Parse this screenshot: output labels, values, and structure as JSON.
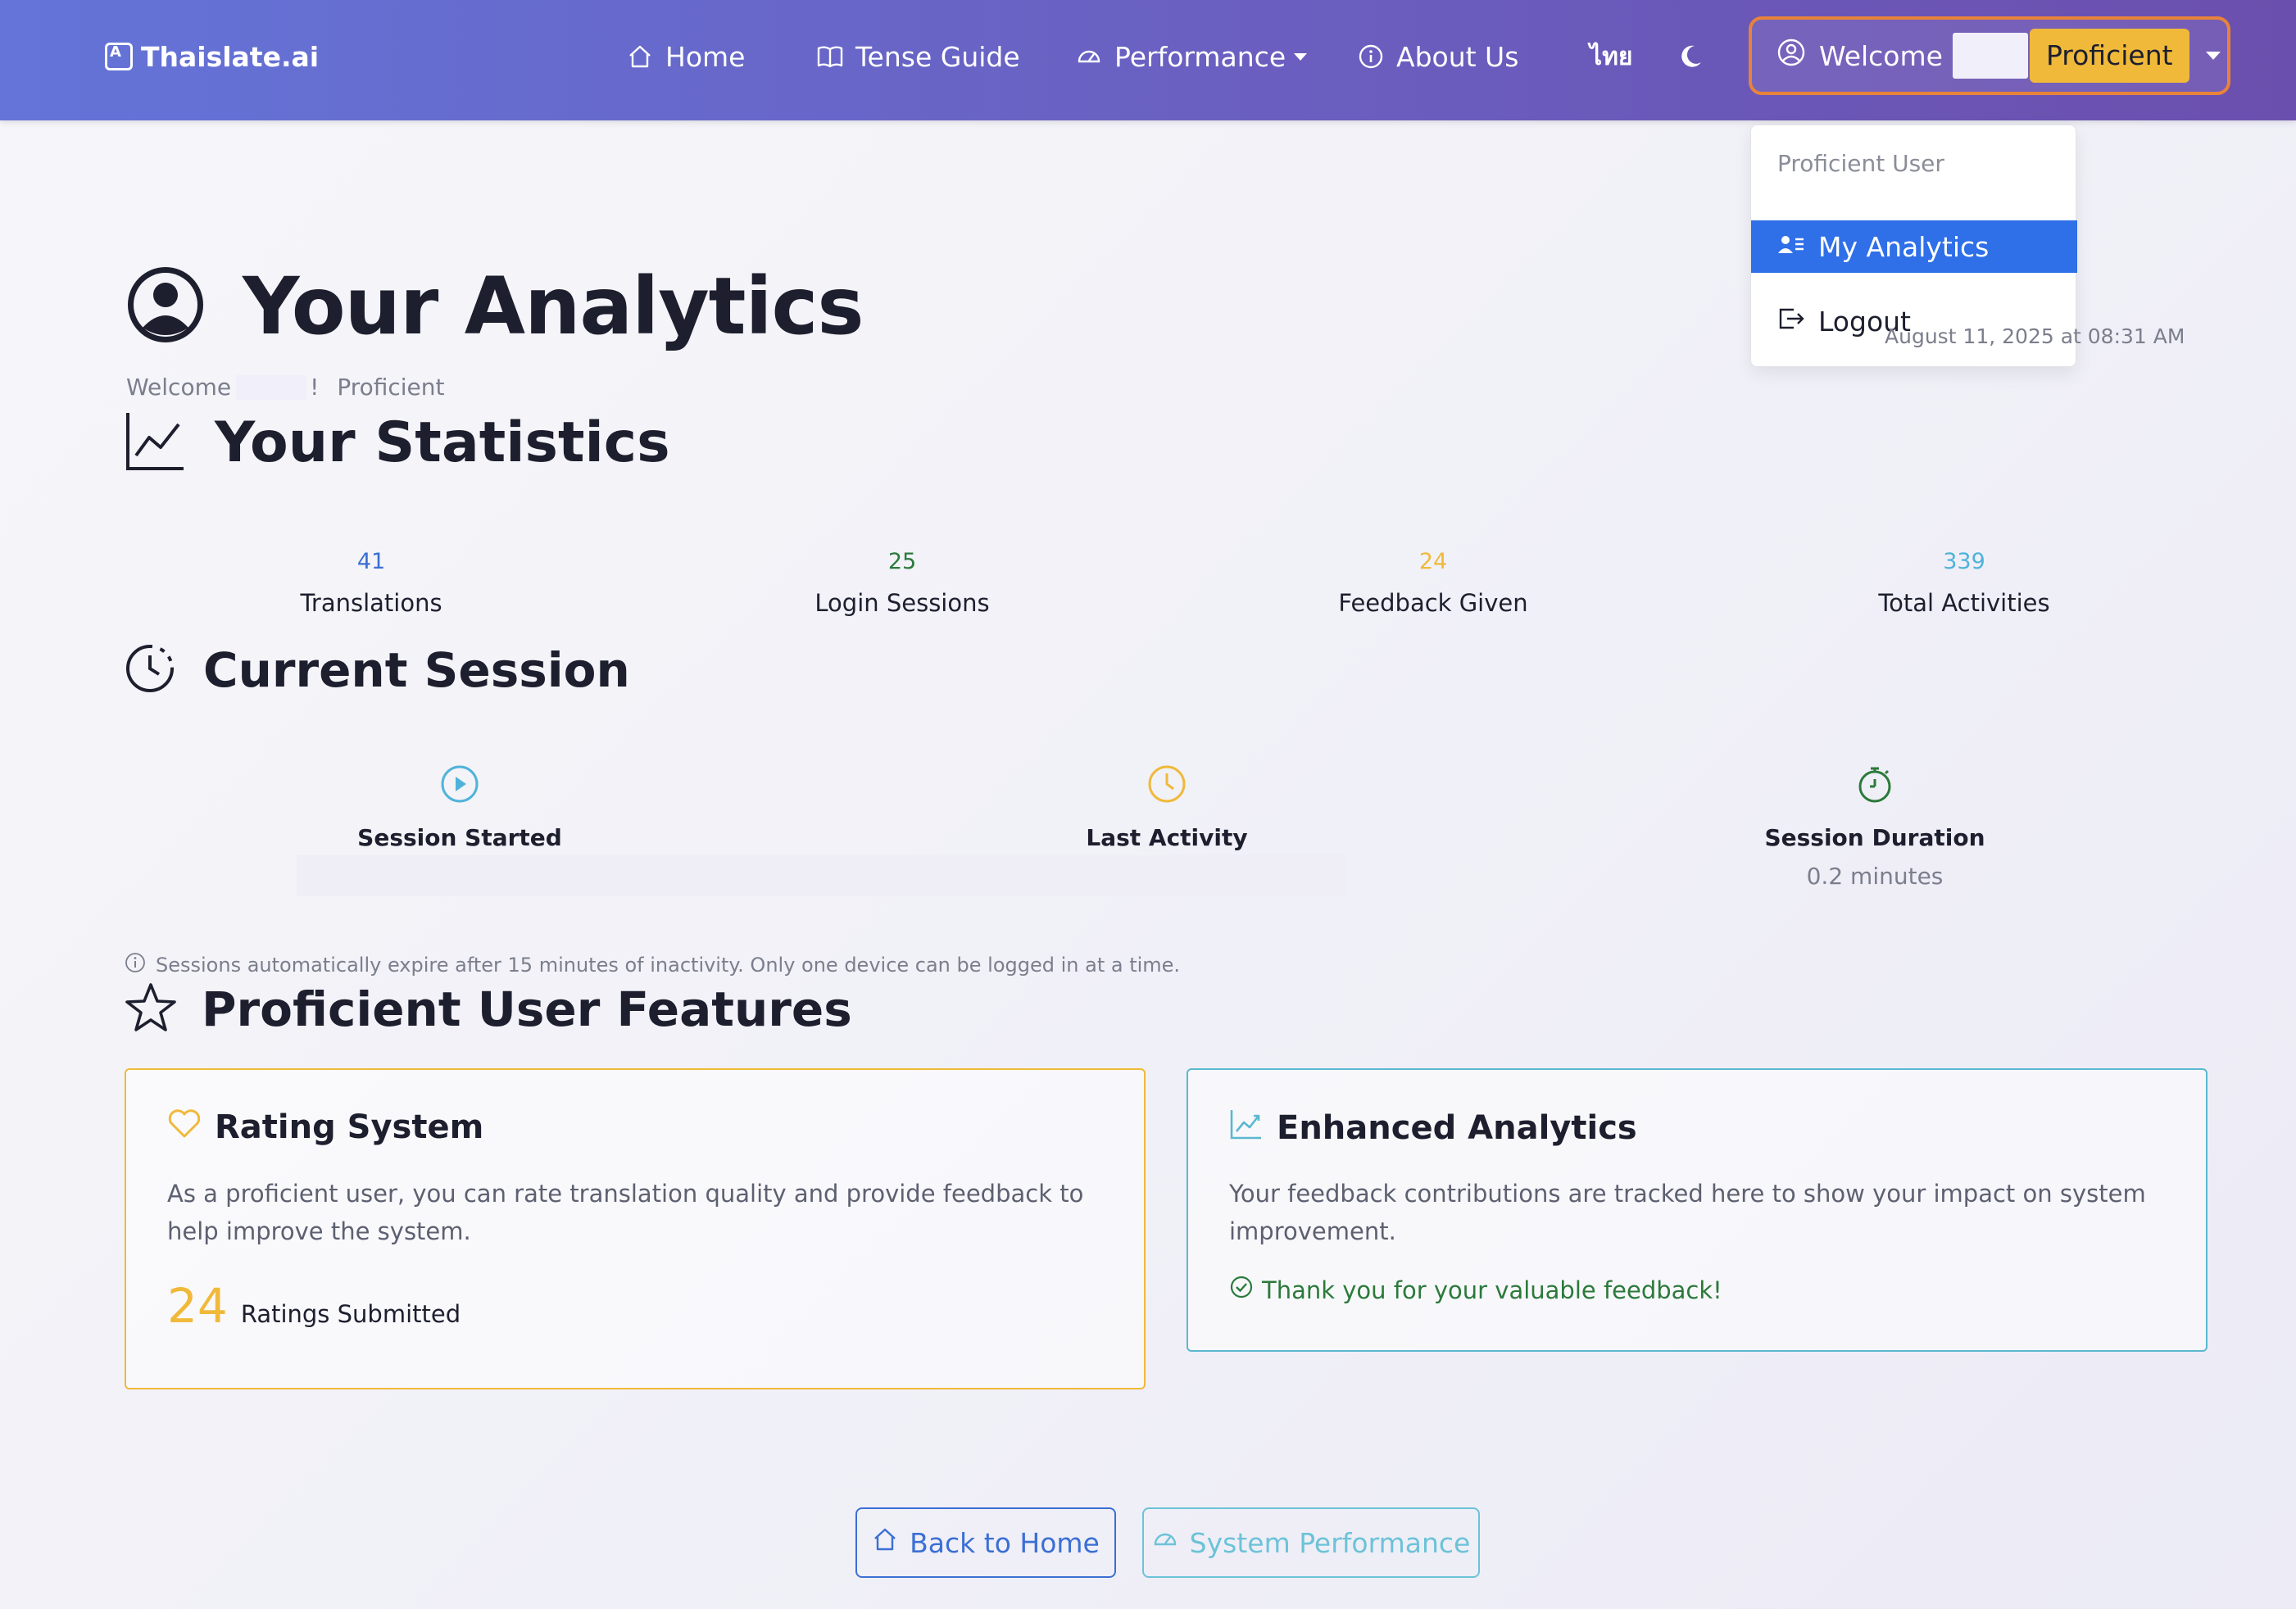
{
  "navbar": {
    "brand": "Thaislate.ai",
    "items": [
      {
        "label": "Home",
        "icon": "home-icon"
      },
      {
        "label": "Tense Guide",
        "icon": "book-icon"
      },
      {
        "label": "Performance",
        "icon": "speedometer-icon"
      },
      {
        "label": "About Us",
        "icon": "info-icon"
      }
    ],
    "language": "ไทย",
    "theme_icon": "moon-icon",
    "user": {
      "welcome": "Welcome",
      "level": "Proficient"
    }
  },
  "dropdown": {
    "header": "Proficient User",
    "items": [
      {
        "label": "My Analytics",
        "icon": "user-list-icon",
        "active": true
      },
      {
        "label": "Logout",
        "icon": "logout-icon"
      }
    ]
  },
  "page": {
    "title": "Your Analytics",
    "welcome": "Welcome",
    "welcome_punct": "!",
    "level": "Proficient",
    "timestamp": "August 11, 2025 at 08:31 AM"
  },
  "statistics": {
    "title": "Your Statistics",
    "items": [
      {
        "value": "41",
        "label": "Translations",
        "color": "#3b6fd4"
      },
      {
        "value": "25",
        "label": "Login Sessions",
        "color": "#2b7a3a"
      },
      {
        "value": "24",
        "label": "Feedback Given",
        "color": "#f0b93a"
      },
      {
        "value": "339",
        "label": "Total Activities",
        "color": "#4fb3d9"
      }
    ]
  },
  "session": {
    "title": "Current Session",
    "items": [
      {
        "label": "Session Started",
        "value": "",
        "icon": "play-circle-icon",
        "color": "#4fb3d9"
      },
      {
        "label": "Last Activity",
        "value": "",
        "icon": "clock-icon",
        "color": "#f0b93a"
      },
      {
        "label": "Session Duration",
        "value": "0.2 minutes",
        "icon": "stopwatch-icon",
        "color": "#2b7a3a"
      }
    ],
    "note": "Sessions automatically expire after 15 minutes of inactivity. Only one device can be logged in at a time."
  },
  "features": {
    "title": "Proficient User Features",
    "rating": {
      "title": "Rating System",
      "text": "As a proficient user, you can rate translation quality and provide feedback to help improve the system.",
      "count": "24",
      "count_label": "Ratings Submitted",
      "border": "#f0b93a"
    },
    "analytics": {
      "title": "Enhanced Analytics",
      "text": "Your feedback contributions are tracked here to show your impact on system improvement.",
      "thanks": "Thank you for your valuable feedback!",
      "border": "#5ab8cf"
    }
  },
  "buttons": {
    "home": "Back to Home",
    "performance": "System Performance"
  }
}
